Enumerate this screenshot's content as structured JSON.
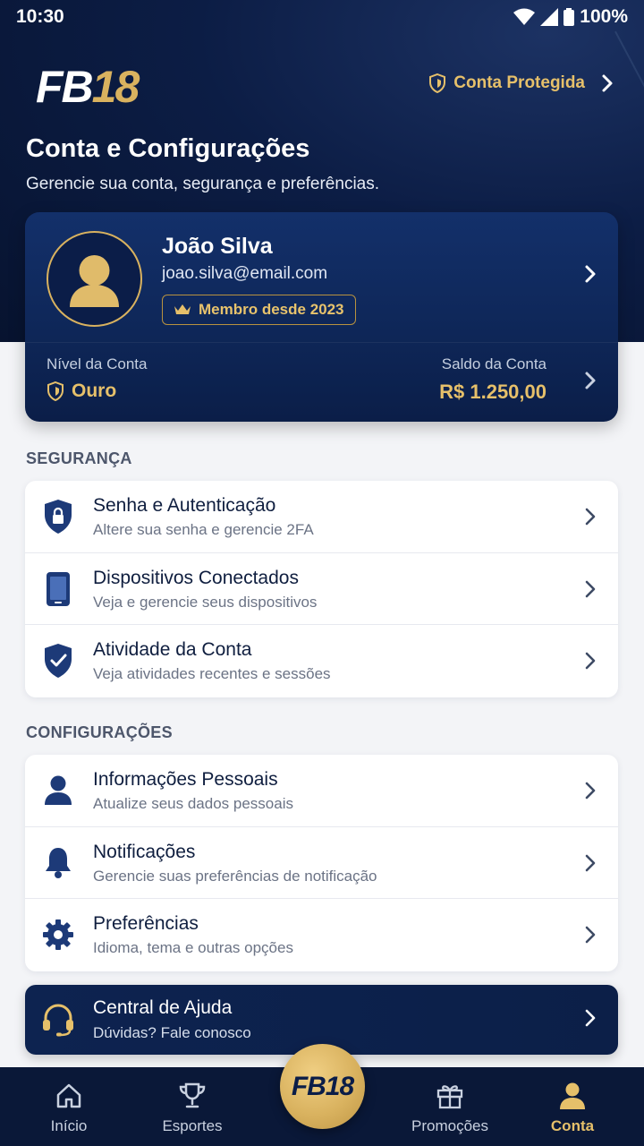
{
  "status_bar": {
    "time": "10:30",
    "battery": "100%"
  },
  "header": {
    "logo_fb": "FB",
    "logo_num": "18",
    "protected_label": "Conta Protegida",
    "title": "Conta e Configurações",
    "subtitle": "Gerencie sua conta, segurança e preferências."
  },
  "profile": {
    "name": "João Silva",
    "email": "joao.silva@email.com",
    "member_since": "Membro desde 2023",
    "level_label": "Nível da Conta",
    "level_value": "Ouro",
    "balance_label": "Saldo da Conta",
    "balance_value": "R$ 1.250,00"
  },
  "security": {
    "section_title": "SEGURANÇA",
    "items": [
      {
        "title": "Senha e Autenticação",
        "subtitle": "Altere sua senha e gerencie 2FA",
        "icon": "shield-lock-icon"
      },
      {
        "title": "Dispositivos Conectados",
        "subtitle": "Veja e gerencie seus dispositivos",
        "icon": "phone-icon"
      },
      {
        "title": "Atividade da Conta",
        "subtitle": "Veja atividades recentes e sessões",
        "icon": "shield-check-icon"
      }
    ]
  },
  "settings": {
    "section_title": "CONFIGURAÇÕES",
    "items": [
      {
        "title": "Informações Pessoais",
        "subtitle": "Atualize seus dados pessoais",
        "icon": "person-icon"
      },
      {
        "title": "Notificações",
        "subtitle": "Gerencie suas preferências de notificação",
        "icon": "bell-icon"
      },
      {
        "title": "Preferências",
        "subtitle": "Idioma, tema e outras opções",
        "icon": "gear-icon"
      }
    ]
  },
  "help": {
    "title": "Central de Ajuda",
    "subtitle": "Dúvidas? Fale conosco",
    "icon": "headset-icon"
  },
  "nav": {
    "items": [
      {
        "label": "Início",
        "icon": "home-icon"
      },
      {
        "label": "Esportes",
        "icon": "trophy-icon"
      },
      {
        "label": "Promoções",
        "icon": "gift-icon"
      },
      {
        "label": "Conta",
        "icon": "person-icon"
      }
    ],
    "center_label": "FB18",
    "active": "Conta"
  },
  "colors": {
    "navy": "#0c1d45",
    "gold": "#d9b25f",
    "accent_text": "#e6c06a",
    "background": "#f3f4f7"
  }
}
